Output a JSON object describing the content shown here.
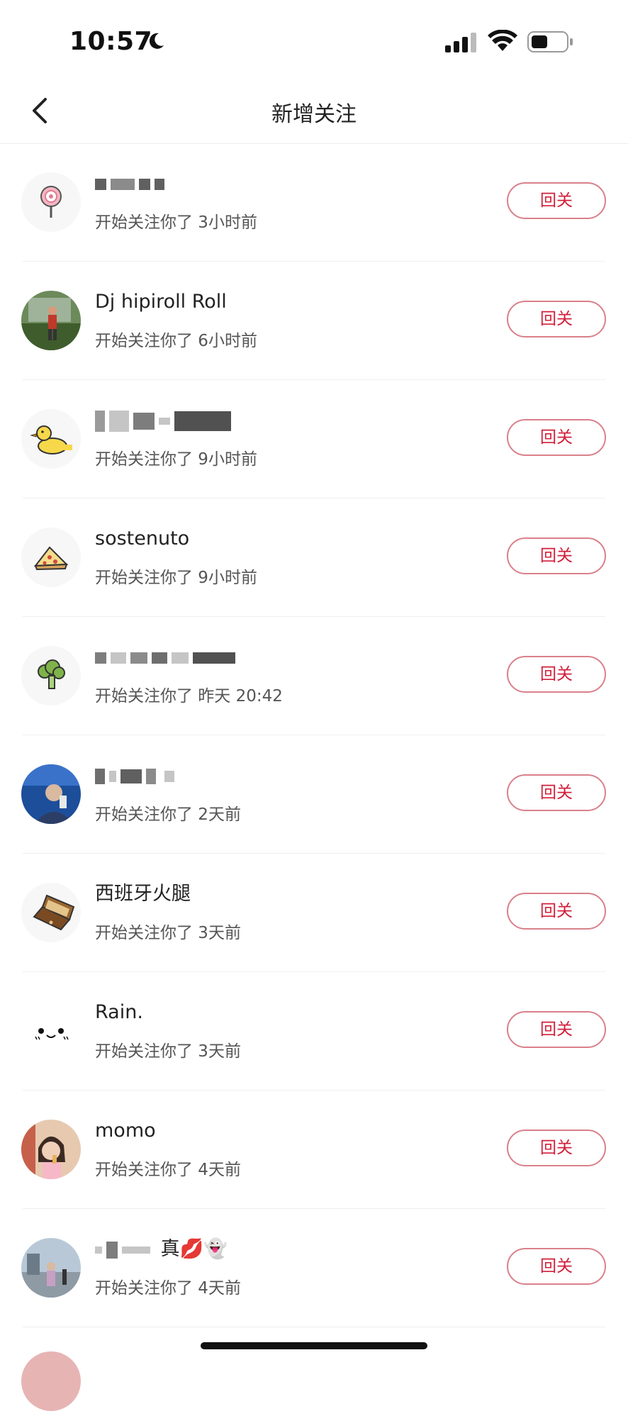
{
  "status_bar": {
    "time": "10:57"
  },
  "nav": {
    "title": "新增关注"
  },
  "follow_button_label": "回关",
  "items": [
    {
      "name": "",
      "subtitle": "开始关注你了 3小时前"
    },
    {
      "name": "Dj hipiroll Roll",
      "subtitle": "开始关注你了 6小时前"
    },
    {
      "name": "",
      "subtitle": "开始关注你了 9小时前"
    },
    {
      "name": "sostenuto",
      "subtitle": "开始关注你了 9小时前"
    },
    {
      "name": "",
      "subtitle": "开始关注你了 昨天 20:42"
    },
    {
      "name": "",
      "subtitle": "开始关注你了 2天前"
    },
    {
      "name": "西班牙火腿",
      "subtitle": "开始关注你了 3天前"
    },
    {
      "name": "Rain.",
      "subtitle": "开始关注你了 3天前"
    },
    {
      "name": "momo",
      "subtitle": "开始关注你了 4天前"
    },
    {
      "name": "真💋👻",
      "subtitle": "开始关注你了 4天前"
    }
  ],
  "colors": {
    "accent": "#d11f3a",
    "button_border": "#d9808a",
    "divider": "#efefef"
  }
}
